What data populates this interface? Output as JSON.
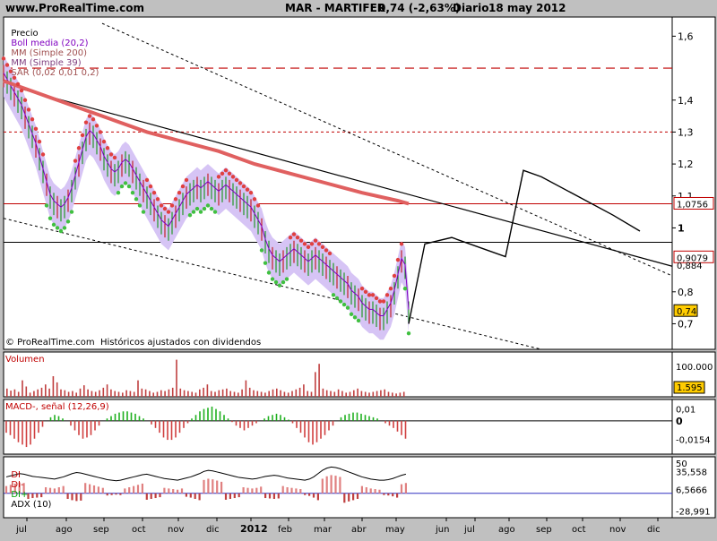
{
  "header": {
    "site": "www.ProRealTime.com",
    "title": "MAR - MARTIFER",
    "quote": "0,74 (-2,63%)",
    "period": "Diario",
    "date": "18 may 2012"
  },
  "legends": {
    "price": [
      {
        "text": "Precio",
        "color": "#000000"
      },
      {
        "text": "Boll media (20,2)",
        "color": "#8000c0"
      },
      {
        "text": "MM (Simple 200)",
        "color": "#a05050"
      },
      {
        "text": "MM (Simple 39)",
        "color": "#804080"
      },
      {
        "text": "SAR (0,02 0,01 0,2)",
        "color": "#a05050"
      }
    ],
    "copyright": "© ProRealTime.com  Históricos ajustados con dividendos",
    "volume": "Volumen",
    "macd": "MACD-, señal (12,26,9)",
    "dmi": [
      {
        "text": "DI",
        "color": "#c00000"
      },
      {
        "text": "DI-",
        "color": "#c00000"
      },
      {
        "text": "DI+",
        "color": "#00a000"
      },
      {
        "text": "ADX (10)",
        "color": "#000000"
      }
    ]
  },
  "chart_data": [
    {
      "type": "line",
      "panel": "price",
      "y_ticks": [
        "1,6",
        "1,4",
        "1,3",
        "1,2",
        "1,1",
        "1",
        "0,8",
        "0,7"
      ],
      "markers": [
        {
          "value": "1,0756",
          "style": "box"
        },
        {
          "value": "0,9079",
          "style": "box"
        },
        {
          "value": "0,884",
          "style": "plain"
        },
        {
          "value": "0,74",
          "style": "highlight"
        }
      ],
      "hlines": [
        1.5,
        1.3,
        1.0756,
        0.955
      ],
      "price": {
        "x": [
          0,
          4,
          8,
          12,
          16,
          20,
          24,
          28,
          32,
          36,
          40,
          44,
          48,
          52,
          56,
          60,
          64,
          68,
          72,
          76,
          80,
          84,
          88,
          92,
          96,
          100,
          104,
          108,
          112,
          116,
          120,
          124,
          128,
          132,
          136,
          140,
          144,
          148,
          152,
          156,
          160,
          164,
          168,
          172,
          176,
          180,
          184,
          188,
          192,
          196,
          200,
          204,
          208,
          212,
          216,
          220,
          224,
          228,
          232,
          236,
          240,
          244,
          248,
          252,
          256,
          260,
          264,
          268,
          272,
          276,
          280,
          284,
          288,
          292,
          296,
          300,
          304,
          308,
          312,
          316,
          320,
          324,
          328,
          332,
          336,
          340,
          344,
          348,
          352,
          356,
          360,
          364,
          368,
          372,
          376,
          380,
          384,
          388,
          392,
          396,
          400,
          404,
          408,
          412,
          416,
          420,
          424,
          428,
          432,
          436,
          440,
          444,
          448,
          452
        ],
        "y": [
          1.48,
          1.46,
          1.44,
          1.42,
          1.4,
          1.38,
          1.35,
          1.32,
          1.29,
          1.26,
          1.22,
          1.18,
          1.14,
          1.1,
          1.08,
          1.07,
          1.06,
          1.07,
          1.09,
          1.12,
          1.16,
          1.2,
          1.24,
          1.28,
          1.3,
          1.29,
          1.27,
          1.25,
          1.22,
          1.2,
          1.18,
          1.17,
          1.18,
          1.2,
          1.21,
          1.2,
          1.18,
          1.16,
          1.14,
          1.12,
          1.1,
          1.08,
          1.06,
          1.04,
          1.02,
          1.01,
          1.0,
          1.02,
          1.04,
          1.06,
          1.08,
          1.1,
          1.11,
          1.12,
          1.13,
          1.12,
          1.13,
          1.14,
          1.13,
          1.12,
          1.11,
          1.12,
          1.13,
          1.12,
          1.11,
          1.1,
          1.09,
          1.08,
          1.07,
          1.06,
          1.04,
          1.02,
          1.0,
          0.96,
          0.93,
          0.91,
          0.9,
          0.89,
          0.9,
          0.91,
          0.92,
          0.93,
          0.92,
          0.91,
          0.9,
          0.89,
          0.9,
          0.91,
          0.9,
          0.89,
          0.88,
          0.87,
          0.86,
          0.85,
          0.84,
          0.83,
          0.82,
          0.8,
          0.79,
          0.78,
          0.76,
          0.75,
          0.74,
          0.74,
          0.73,
          0.72,
          0.72,
          0.74,
          0.76,
          0.8,
          0.85,
          0.9,
          0.88,
          0.74
        ]
      },
      "sma200": {
        "x": [
          0,
          40,
          80,
          120,
          160,
          200,
          240,
          280,
          320,
          360,
          400,
          440,
          452
        ],
        "y": [
          1.46,
          1.42,
          1.38,
          1.34,
          1.3,
          1.27,
          1.24,
          1.2,
          1.17,
          1.14,
          1.11,
          1.085,
          1.0756
        ]
      },
      "projection": {
        "x": [
          452,
          470,
          500,
          540,
          560,
          580,
          600,
          640,
          680,
          710
        ],
        "y": [
          0.7,
          0.95,
          0.97,
          0.93,
          0.91,
          1.18,
          1.16,
          1.1,
          1.04,
          0.99
        ]
      }
    },
    {
      "type": "bar",
      "panel": "volume",
      "y_ticks": [
        "100.000"
      ],
      "last_value": "1.595",
      "bars": [
        20,
        15,
        18,
        12,
        40,
        25,
        10,
        14,
        18,
        22,
        30,
        20,
        50,
        35,
        18,
        16,
        12,
        14,
        10,
        20,
        28,
        18,
        14,
        12,
        16,
        22,
        30,
        18,
        14,
        12,
        10,
        16,
        14,
        12,
        40,
        20,
        18,
        14,
        10,
        12,
        16,
        14,
        18,
        22,
        90,
        20,
        16,
        14,
        12,
        10,
        18,
        22,
        30,
        14,
        12,
        16,
        18,
        20,
        14,
        12,
        10,
        18,
        40,
        22,
        16,
        14,
        12,
        10,
        14,
        18,
        20,
        16,
        12,
        10,
        14,
        18,
        22,
        30,
        14,
        12,
        60,
        80,
        20,
        16,
        14,
        12,
        18,
        14,
        10,
        12,
        16,
        20,
        14,
        12,
        10,
        12,
        14,
        16,
        18,
        12,
        10,
        8,
        10,
        12
      ]
    },
    {
      "type": "bar",
      "panel": "macd",
      "y_ticks": [
        "0,01",
        "0"
      ],
      "last_value": "-0,0154",
      "values": [
        -0.01,
        -0.012,
        -0.015,
        -0.018,
        -0.02,
        -0.022,
        -0.02,
        -0.015,
        -0.01,
        -0.005,
        0,
        0.003,
        0.005,
        0.004,
        0.002,
        0,
        -0.004,
        -0.008,
        -0.012,
        -0.015,
        -0.014,
        -0.012,
        -0.008,
        -0.004,
        0,
        0.002,
        0.004,
        0.006,
        0.007,
        0.008,
        0.008,
        0.007,
        0.006,
        0.004,
        0.002,
        0,
        -0.003,
        -0.006,
        -0.01,
        -0.014,
        -0.016,
        -0.016,
        -0.014,
        -0.01,
        -0.006,
        -0.002,
        0.002,
        0.005,
        0.008,
        0.01,
        0.011,
        0.012,
        0.01,
        0.008,
        0.005,
        0.002,
        -0.001,
        -0.004,
        -0.006,
        -0.008,
        -0.006,
        -0.004,
        -0.002,
        0,
        0.002,
        0.004,
        0.005,
        0.006,
        0.005,
        0.003,
        0.001,
        -0.002,
        -0.006,
        -0.01,
        -0.014,
        -0.018,
        -0.02,
        -0.018,
        -0.015,
        -0.012,
        -0.008,
        -0.004,
        0,
        0.003,
        0.005,
        0.006,
        0.007,
        0.007,
        0.006,
        0.005,
        0.004,
        0.003,
        0.002,
        0,
        -0.002,
        -0.004,
        -0.006,
        -0.009,
        -0.012,
        -0.015
      ]
    },
    {
      "type": "line",
      "panel": "dmi",
      "y_ticks": [
        "50"
      ],
      "markers": [
        {
          "value": "35,558",
          "style": "plain"
        },
        {
          "value": "6,5666",
          "style": "plain"
        },
        {
          "value": "-28,991",
          "style": "plain"
        }
      ],
      "adx": [
        30,
        32,
        34,
        36,
        35,
        33,
        31,
        30,
        29,
        28,
        27,
        26,
        28,
        30,
        33,
        36,
        38,
        37,
        35,
        33,
        31,
        29,
        27,
        25,
        24,
        23,
        24,
        26,
        28,
        30,
        32,
        34,
        35,
        33,
        31,
        29,
        27,
        26,
        25,
        24,
        26,
        28,
        30,
        33,
        36,
        40,
        42,
        41,
        39,
        37,
        35,
        33,
        31,
        29,
        28,
        27,
        26,
        27,
        29,
        31,
        32,
        33,
        32,
        30,
        28,
        27,
        26,
        25,
        24,
        26,
        30,
        36,
        42,
        46,
        48,
        47,
        45,
        42,
        39,
        36,
        33,
        30,
        28,
        26,
        25,
        24,
        24,
        25,
        27,
        30,
        33,
        35
      ]
    }
  ],
  "x_axis": {
    "labels": [
      "jul",
      "ago",
      "sep",
      "oct",
      "nov",
      "dic",
      "2012",
      "feb",
      "mar",
      "abr",
      "may",
      "jun",
      "jul",
      "ago",
      "sep",
      "oct",
      "nov",
      "dic"
    ]
  }
}
